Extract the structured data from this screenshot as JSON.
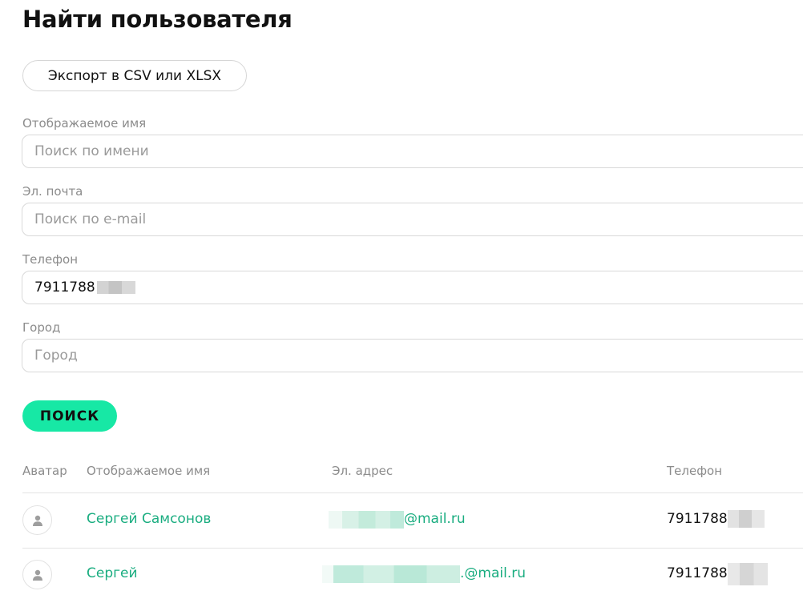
{
  "page": {
    "title": "Найти пользователя",
    "export_label": "Экспорт в CSV или XLSX"
  },
  "form": {
    "display_name": {
      "label": "Отображаемое имя",
      "placeholder": "Поиск по имени",
      "value": ""
    },
    "email": {
      "label": "Эл. почта",
      "placeholder": "Поиск по e-mail",
      "value": ""
    },
    "phone": {
      "label": "Телефон",
      "placeholder": "",
      "value": "7911788"
    },
    "city": {
      "label": "Город",
      "placeholder": "Город",
      "value": ""
    },
    "search_label": "ПОИСК"
  },
  "table": {
    "headers": [
      "Аватар",
      "Отображаемое имя",
      "Эл. адрес",
      "Телефон"
    ],
    "rows": [
      {
        "avatar_icon": "user-icon",
        "name": "Сергей Самсонов",
        "email": "@mail.ru",
        "phone": "7911788"
      },
      {
        "avatar_icon": "user-icon",
        "name": "Сергей",
        "email": ".@mail.ru",
        "phone": "7911788"
      }
    ]
  },
  "colors": {
    "accent": "#17e8a5",
    "link": "#1aad80",
    "muted_text": "#8c8c8c",
    "border": "#d9d9d9"
  }
}
